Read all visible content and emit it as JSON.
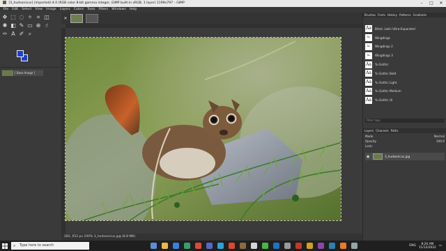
{
  "window": {
    "title": "[3_hudsonicus] (imported)-4.0 (RGB color 8-bit gamma integer, GIMP built-in sRGB, 1 layer) 1199x797 – GIMP",
    "controls": [
      "–",
      "□",
      "✕"
    ]
  },
  "menu": [
    "File",
    "Edit",
    "Select",
    "View",
    "Image",
    "Layers",
    "Colors",
    "Tools",
    "Filters",
    "Windows",
    "Help"
  ],
  "images_panel": {
    "item_label": "[ Base Image ]"
  },
  "status": {
    "text": "282, 653      px   100%   3_hudsonicus.jpg (8.8 MB)"
  },
  "fonts_panel": {
    "tabs": [
      "Brushes",
      "Fonts",
      "History",
      "Patterns",
      "Gradients"
    ],
    "fonts": [
      {
        "preview": "Aa",
        "name": "Bitstr. Latin Ultra-Expanded"
      },
      {
        "preview": "✁",
        "name": "Wingdings"
      },
      {
        "preview": "✁",
        "name": "Wingdings 2"
      },
      {
        "preview": "✁",
        "name": "Wingdings 3"
      },
      {
        "preview": "Aa",
        "name": "Yu Gothic"
      },
      {
        "preview": "Aa",
        "name": "Yu Gothic Bold"
      },
      {
        "preview": "Aa",
        "name": "Yu Gothic Light"
      },
      {
        "preview": "Aa",
        "name": "Yu Gothic Medium"
      },
      {
        "preview": "Aa",
        "name": "Yu Gothic UI"
      }
    ],
    "filter_placeholder": "Filter tags"
  },
  "layers_panel": {
    "tabs": [
      "Layers",
      "Channels",
      "Paths"
    ],
    "mode_label": "Mode",
    "mode_value": "Normal",
    "opacity_label": "Opacity",
    "opacity_value": "100.0",
    "lock_label": "Lock:",
    "layer_name": "3_hudsonicus.jpg"
  },
  "taskbar": {
    "search_placeholder": "Type here to search",
    "lang": "ENG",
    "time": "8:26 AM",
    "date": "11/12/2022",
    "app_colors": [
      "#5a8fd8",
      "#e8b84a",
      "#3b7fd9",
      "#35a06a",
      "#d94a3b",
      "#5865c8",
      "#2aa4d6",
      "#e2462b",
      "#8a6b3e",
      "#d6d6d6",
      "#4bb543",
      "#1e73be",
      "#999999",
      "#c0392b",
      "#d4a017",
      "#8e44ad",
      "#2c7fb8",
      "#e67e22",
      "#95a5a6"
    ]
  }
}
